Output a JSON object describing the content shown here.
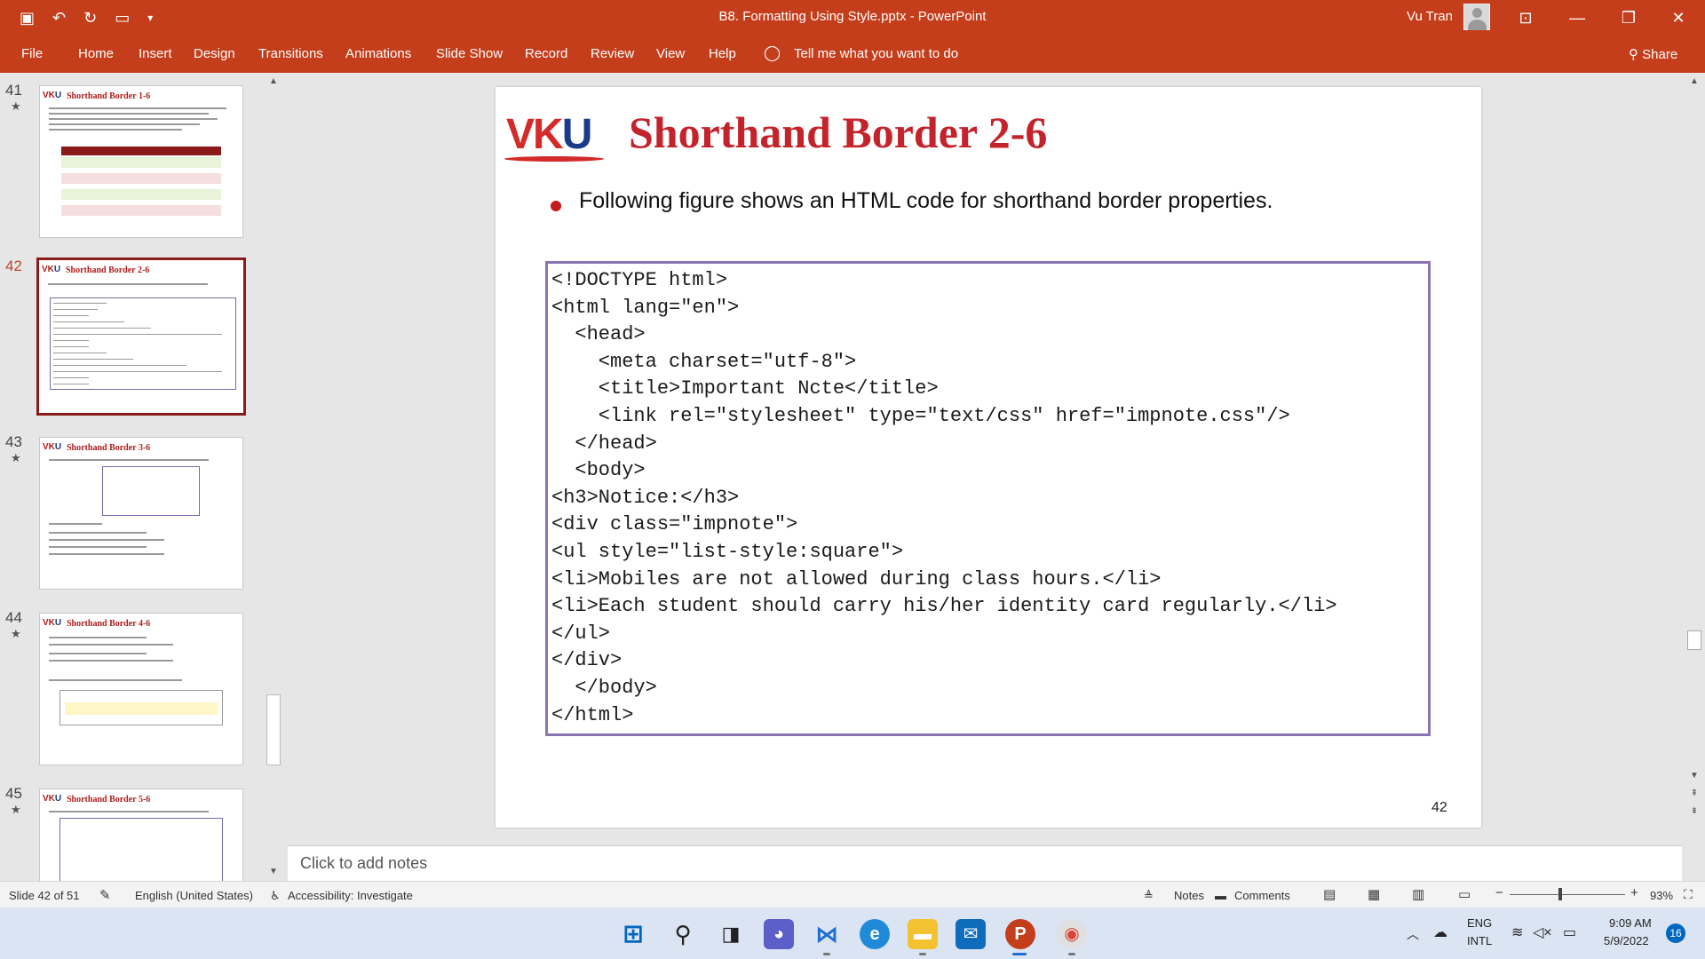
{
  "window": {
    "title": "B8. Formatting Using Style.pptx  -  PowerPoint",
    "user_name": "Vu Tran",
    "ribbon_display_icon": "⊡",
    "minimize_icon": "—",
    "restore_icon": "❐",
    "close_icon": "✕"
  },
  "qat": {
    "save_icon": "▣",
    "undo_icon": "↶",
    "redo_icon": "↻",
    "present_icon": "▭",
    "customize_icon": "▾"
  },
  "ribbon": {
    "tabs": [
      "File",
      "Home",
      "Insert",
      "Design",
      "Transitions",
      "Animations",
      "Slide Show",
      "Record",
      "Review",
      "View",
      "Help"
    ],
    "tell_me": "Tell me what you want to do",
    "share": "Share"
  },
  "thumbnails": [
    {
      "number": "41",
      "title": "Shorthand Border 1-6"
    },
    {
      "number": "42",
      "title": "Shorthand Border 2-6"
    },
    {
      "number": "43",
      "title": "Shorthand Border 3-6"
    },
    {
      "number": "44",
      "title": "Shorthand Border 4-6"
    },
    {
      "number": "45",
      "title": "Shorthand Border 5-6"
    }
  ],
  "slide": {
    "logo_v": "V",
    "logo_k": "K",
    "logo_u": "U",
    "title": "Shorthand Border 2-6",
    "bullet": "Following figure shows an HTML code for shorthand border properties.",
    "code_lines": [
      "<!DOCTYPE html>",
      "<html lang=\"en\">",
      "  <head>",
      "    <meta charset=\"utf-8\">",
      "    <title>Important Ncte</title>",
      "    <link rel=\"stylesheet\" type=\"text/css\" href=\"impnote.css\"/>",
      "  </head>",
      "  <body>",
      "<h3>Notice:</h3>",
      "<div class=\"impnote\">",
      "<ul style=\"list-style:square\">",
      "<li>Mobiles are not allowed during class hours.</li>",
      "<li>Each student should carry his/her identity card regularly.</li>",
      "</ul>",
      "</div>",
      "  </body>",
      "</html>"
    ],
    "number": "42"
  },
  "notes": {
    "placeholder": "Click to add notes"
  },
  "status": {
    "slide_info": "Slide 42 of 51",
    "language": "English (United States)",
    "accessibility": "Accessibility: Investigate",
    "notes": "Notes",
    "comments": "Comments",
    "zoom": "93%"
  },
  "taskbar": {
    "lang_top": "ENG",
    "lang_bottom": "INTL",
    "time": "9:09 AM",
    "date": "5/9/2022",
    "notifications": "16"
  },
  "colors": {
    "accent": "#c43e1c",
    "title_red": "#c4232b",
    "code_border": "#8a74b4"
  }
}
